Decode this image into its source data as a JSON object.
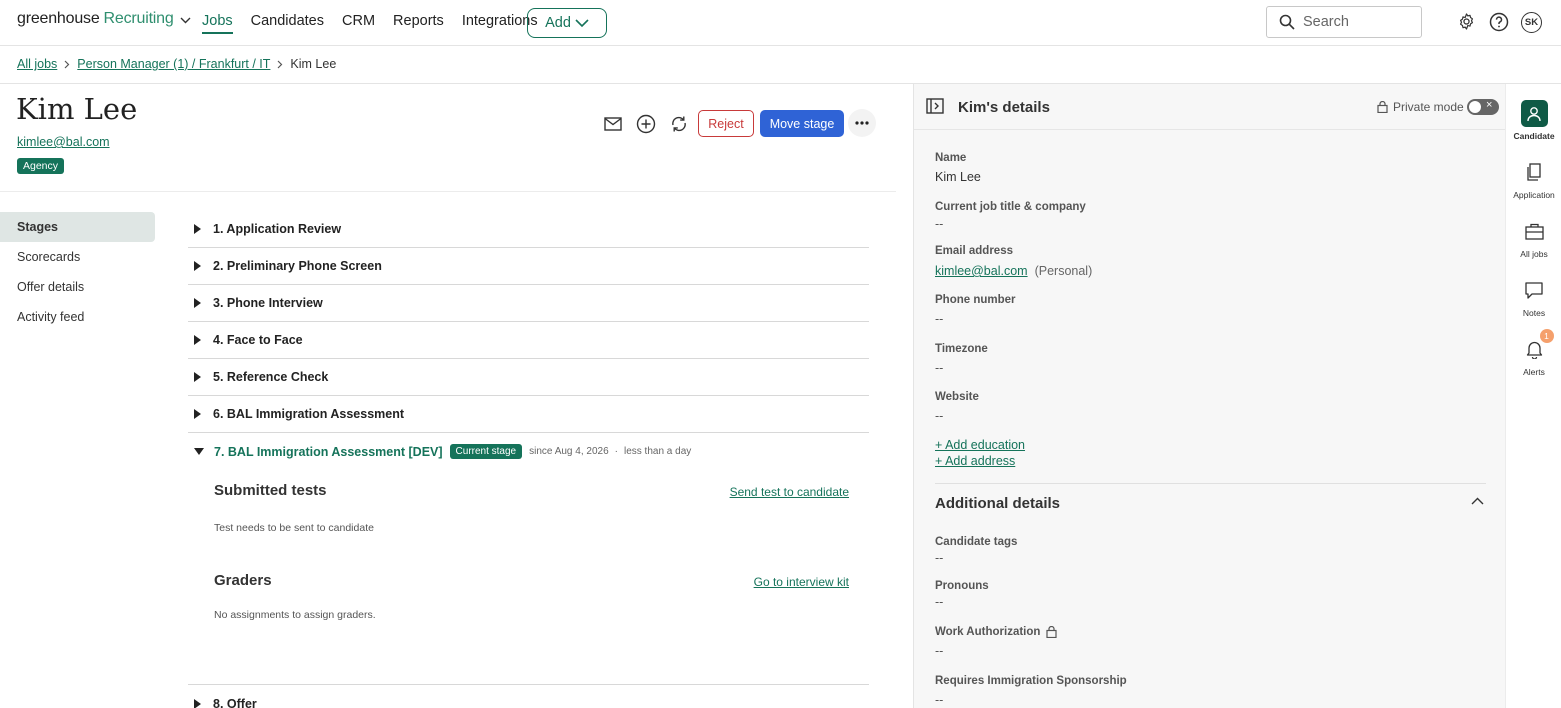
{
  "nav": {
    "logo_text": "greenhouse",
    "logo_product": "Recruiting",
    "links": [
      "Jobs",
      "Candidates",
      "CRM",
      "Reports",
      "Integrations"
    ],
    "add_label": "Add",
    "search_placeholder": "Search",
    "avatar_initials": "SK"
  },
  "breadcrumb": {
    "all_jobs": "All jobs",
    "job": "Person Manager (1) / Frankfurt / IT",
    "current": "Kim Lee"
  },
  "candidate": {
    "name": "Kim Lee",
    "email": "kimlee@bal.com",
    "source_tag": "Agency"
  },
  "actions": {
    "reject_label": "Reject",
    "move_stage_label": "Move stage"
  },
  "leftnav": [
    "Stages",
    "Scorecards",
    "Offer details",
    "Activity feed"
  ],
  "stages": {
    "items": [
      "1. Application Review",
      "2. Preliminary Phone Screen",
      "3. Phone Interview",
      "4. Face to Face",
      "5. Reference Check",
      "6. BAL Immigration Assessment"
    ],
    "current": {
      "label": "7. BAL Immigration Assessment [DEV]",
      "badge": "Current stage",
      "since": "since Aug 4, 2026",
      "duration": "less than a day",
      "submitted_title": "Submitted tests",
      "send_test_link": "Send test to candidate",
      "submitted_note": "Test needs to be sent to candidate",
      "graders_title": "Graders",
      "interview_kit_link": "Go to interview kit",
      "graders_note": "No assignments to assign graders."
    },
    "last": "8. Offer"
  },
  "details": {
    "title": "Kim's details",
    "private_mode": "Private mode",
    "name_label": "Name",
    "name_value": "Kim Lee",
    "job_label": "Current job title & company",
    "job_value": "--",
    "email_label": "Email address",
    "email_value": "kimlee@bal.com",
    "email_type": "(Personal)",
    "phone_label": "Phone number",
    "phone_value": "--",
    "tz_label": "Timezone",
    "tz_value": "--",
    "web_label": "Website",
    "web_value": "--",
    "add_education": "+ Add education",
    "add_address": "+ Add address",
    "additional_title": "Additional details",
    "tags_label": "Candidate tags",
    "tags_value": "--",
    "pronouns_label": "Pronouns",
    "pronouns_value": "--",
    "work_auth_label": "Work Authorization",
    "work_auth_value": "--",
    "sponsor_label": "Requires Immigration Sponsorship",
    "sponsor_value": "--"
  },
  "rail": {
    "candidate": "Candidate",
    "application": "Application",
    "all_jobs": "All jobs",
    "notes": "Notes",
    "alerts": "Alerts",
    "alerts_count": "1"
  },
  "colors": {
    "brand_green": "#15735a",
    "primary_blue": "#2f63d6",
    "reject_red": "#c83a3a"
  }
}
